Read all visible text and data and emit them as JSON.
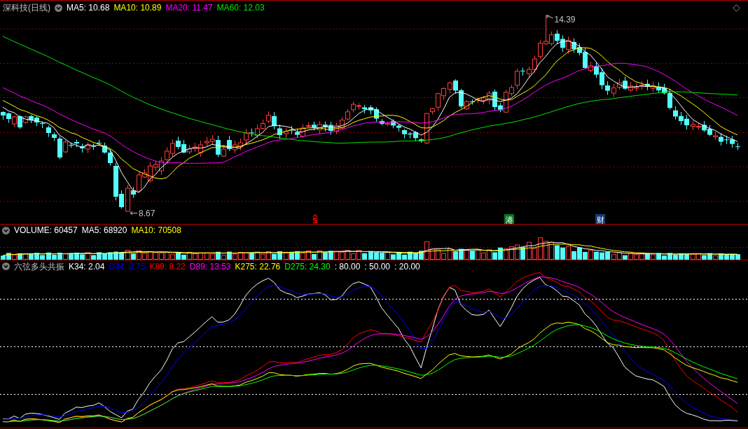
{
  "main_chart": {
    "title": "深科技(日线)",
    "indicators": [
      {
        "label": "MA5: 10.68",
        "color": "#ffffff"
      },
      {
        "label": "MA10: 10.89",
        "color": "#ffff00"
      },
      {
        "label": "MA20: 11.47",
        "color": "#ff00ff"
      },
      {
        "label": "MA60: 12.03",
        "color": "#00e600"
      }
    ],
    "high_label": "14.39",
    "low_label": "8.67",
    "event_markers": [
      {
        "kind": "signal",
        "text": "S",
        "color": "#ff0000"
      },
      {
        "kind": "badge",
        "text": "港",
        "color": "#007a1e"
      },
      {
        "kind": "badge",
        "text": "财",
        "color": "#143c78"
      }
    ]
  },
  "volume_panel": {
    "indicators": [
      {
        "kind": "bars",
        "label": "VOLUME: 60457",
        "color": "#ffffff"
      },
      {
        "kind": "line",
        "label": "MA5: 68920",
        "color": "#ffffff"
      },
      {
        "kind": "line",
        "label": "MA10: 70508",
        "color": "#ffff00"
      }
    ]
  },
  "oscillator_panel": {
    "title": "六弦多头共振",
    "indicators": [
      {
        "kind": "line",
        "label": "K34: 2.04",
        "color": "#ffffff"
      },
      {
        "kind": "line",
        "label": "D34: 3.75",
        "color": "#0000ff"
      },
      {
        "kind": "line",
        "label": "K89: 8.22",
        "color": "#ff0000"
      },
      {
        "kind": "line",
        "label": "D89: 13.53",
        "color": "#ff00ff"
      },
      {
        "kind": "line",
        "label": "K275: 22.76",
        "color": "#ffff00"
      },
      {
        "kind": "line",
        "label": "D275: 24.30",
        "color": "#00ff00"
      },
      {
        "kind": "level",
        "label": ": 80.00",
        "color": "#ffffff"
      },
      {
        "kind": "level",
        "label": ": 50.00",
        "color": "#ffffff"
      },
      {
        "kind": "level",
        "label": ": 20.00",
        "color": "#ffffff"
      }
    ]
  }
}
